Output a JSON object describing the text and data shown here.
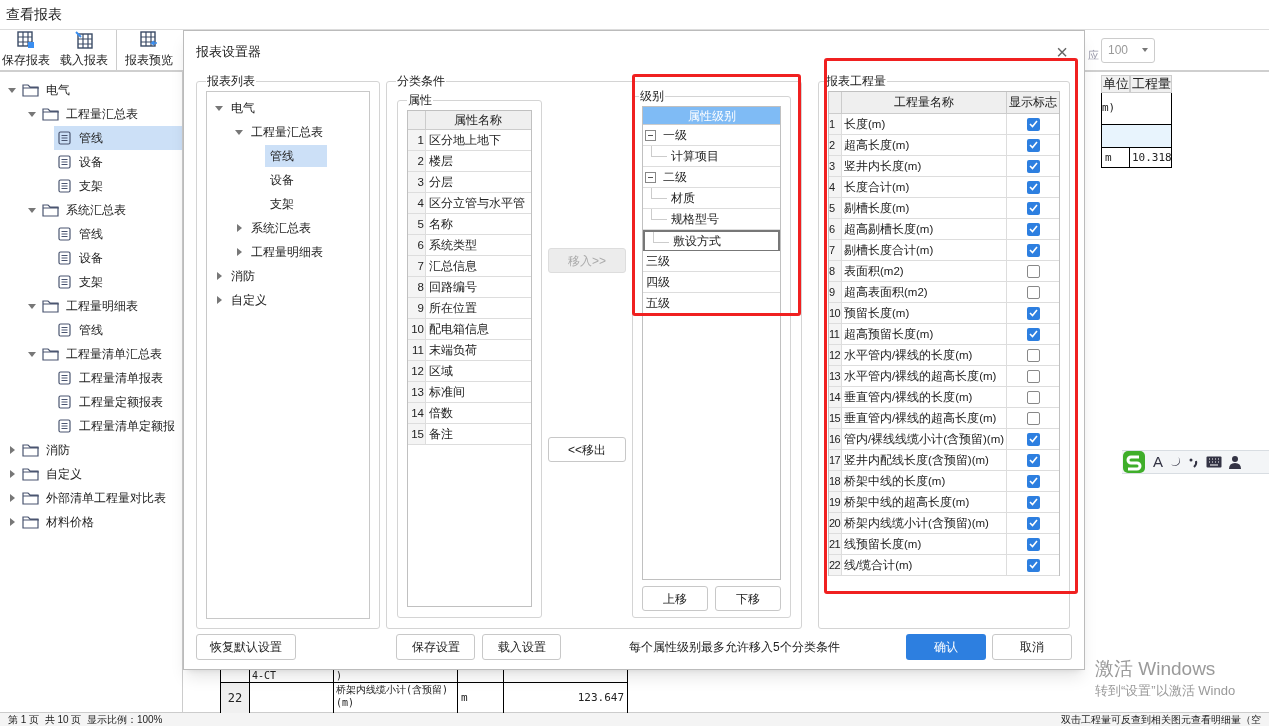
{
  "window": {
    "title": "查看报表"
  },
  "toolbar": [
    {
      "label": "保存报表"
    },
    {
      "label": "载入报表"
    },
    {
      "label": "报表预览"
    }
  ],
  "sidebar": {
    "tree": [
      {
        "kind": "folder",
        "label": "电气",
        "expanded": true,
        "selected": false,
        "children": [
          {
            "kind": "folder",
            "label": "工程量汇总表",
            "expanded": true,
            "selected": false,
            "children": [
              {
                "kind": "report",
                "label": "管线",
                "selected": true
              },
              {
                "kind": "report",
                "label": "设备",
                "selected": false
              },
              {
                "kind": "report",
                "label": "支架",
                "selected": false
              }
            ]
          },
          {
            "kind": "folder",
            "label": "系统汇总表",
            "expanded": true,
            "selected": false,
            "children": [
              {
                "kind": "report",
                "label": "管线",
                "selected": false
              },
              {
                "kind": "report",
                "label": "设备",
                "selected": false
              },
              {
                "kind": "report",
                "label": "支架",
                "selected": false
              }
            ]
          },
          {
            "kind": "folder",
            "label": "工程量明细表",
            "expanded": true,
            "selected": false,
            "children": [
              {
                "kind": "report",
                "label": "管线",
                "selected": false
              }
            ]
          },
          {
            "kind": "folder",
            "label": "工程量清单汇总表",
            "expanded": true,
            "selected": false,
            "children": [
              {
                "kind": "report",
                "label": "工程量清单报表",
                "selected": false
              },
              {
                "kind": "report",
                "label": "工程量定额报表",
                "selected": false
              },
              {
                "kind": "report",
                "label": "工程量清单定额报",
                "selected": false
              }
            ]
          }
        ]
      },
      {
        "kind": "folder",
        "label": "消防",
        "expanded": false,
        "selected": false
      },
      {
        "kind": "folder",
        "label": "自定义",
        "expanded": false,
        "selected": false
      },
      {
        "kind": "folder",
        "label": "外部清单工程量对比表",
        "expanded": false,
        "selected": false
      },
      {
        "kind": "folder",
        "label": "材料价格",
        "expanded": false,
        "selected": false
      }
    ]
  },
  "preview": {
    "partial_label": "应",
    "zoom": "100",
    "columns": [
      "单位",
      "工程量"
    ],
    "top_rows": [
      {
        "text": "m)"
      },
      {
        "unit": "m",
        "amount": "10.318"
      }
    ],
    "bottom_rows": [
      {
        "code": "4-CT",
        "name": ")"
      },
      {
        "number": "22",
        "name": "桥架内线缆小计(含预留)(m)",
        "unit": "m",
        "amount": "123.647"
      }
    ]
  },
  "dialog": {
    "title": "报表设置器",
    "close": "×",
    "report_list": {
      "title": "报表列表",
      "tree": [
        {
          "kind": "folder",
          "label": "电气",
          "expanded": true,
          "selected": false,
          "children": [
            {
              "kind": "folder",
              "label": "工程量汇总表",
              "expanded": true,
              "selected": false,
              "children": [
                {
                  "kind": "report",
                  "label": "管线",
                  "selected": true
                },
                {
                  "kind": "report",
                  "label": "设备",
                  "selected": false
                },
                {
                  "kind": "report",
                  "label": "支架",
                  "selected": false
                }
              ]
            },
            {
              "kind": "folder",
              "label": "系统汇总表",
              "expanded": false,
              "selected": false
            },
            {
              "kind": "folder",
              "label": "工程量明细表",
              "expanded": false,
              "selected": false
            }
          ]
        },
        {
          "kind": "folder",
          "label": "消防",
          "expanded": false,
          "selected": false
        },
        {
          "kind": "folder",
          "label": "自定义",
          "expanded": false,
          "selected": false
        }
      ]
    },
    "conditions": {
      "title": "分类条件",
      "attributes": {
        "title": "属性",
        "column": "属性名称",
        "rows": [
          {
            "no": "1",
            "name": "区分地上地下"
          },
          {
            "no": "2",
            "name": "楼层"
          },
          {
            "no": "3",
            "name": "分层"
          },
          {
            "no": "4",
            "name": "区分立管与水平管"
          },
          {
            "no": "5",
            "name": "名称"
          },
          {
            "no": "6",
            "name": "系统类型"
          },
          {
            "no": "7",
            "name": "汇总信息"
          },
          {
            "no": "8",
            "name": "回路编号"
          },
          {
            "no": "9",
            "name": "所在位置"
          },
          {
            "no": "10",
            "name": "配电箱信息"
          },
          {
            "no": "11",
            "name": "末端负荷"
          },
          {
            "no": "12",
            "name": "区域"
          },
          {
            "no": "13",
            "name": "标准间"
          },
          {
            "no": "14",
            "name": "倍数"
          },
          {
            "no": "15",
            "name": "备注"
          }
        ]
      },
      "move_in": {
        "label": "移入>>",
        "disabled": true
      },
      "move_out": {
        "label": "<<移出",
        "disabled": false
      },
      "levels": {
        "title": "级别",
        "column": "属性级别",
        "items": [
          {
            "kind": "group",
            "label": "一级",
            "expanded": true,
            "selected": false,
            "children": [
              {
                "label": "计算项目",
                "selected": false
              }
            ]
          },
          {
            "kind": "group",
            "label": "二级",
            "expanded": true,
            "selected": false,
            "children": [
              {
                "label": "材质",
                "selected": false
              },
              {
                "label": "规格型号",
                "selected": false
              },
              {
                "label": "敷设方式",
                "selected": true
              }
            ]
          },
          {
            "kind": "plain",
            "label": "三级",
            "selected": false
          },
          {
            "kind": "plain",
            "label": "四级",
            "selected": false
          },
          {
            "kind": "plain",
            "label": "五级",
            "selected": false
          }
        ],
        "buttons": [
          "上移",
          "下移"
        ]
      }
    },
    "quantities": {
      "title": "报表工程量",
      "columns": [
        "工程量名称",
        "显示标志"
      ],
      "rows": [
        {
          "no": "1",
          "name": "长度(m)",
          "checked": true
        },
        {
          "no": "2",
          "name": "超高长度(m)",
          "checked": true
        },
        {
          "no": "3",
          "name": "竖井内长度(m)",
          "checked": true
        },
        {
          "no": "4",
          "name": "长度合计(m)",
          "checked": true
        },
        {
          "no": "5",
          "name": "剔槽长度(m)",
          "checked": true
        },
        {
          "no": "6",
          "name": "超高剔槽长度(m)",
          "checked": true
        },
        {
          "no": "7",
          "name": "剔槽长度合计(m)",
          "checked": true
        },
        {
          "no": "8",
          "name": "表面积(m2)",
          "checked": false
        },
        {
          "no": "9",
          "name": "超高表面积(m2)",
          "checked": false
        },
        {
          "no": "10",
          "name": "预留长度(m)",
          "checked": true
        },
        {
          "no": "11",
          "name": "超高预留长度(m)",
          "checked": true
        },
        {
          "no": "12",
          "name": "水平管内/裸线的长度(m)",
          "checked": false
        },
        {
          "no": "13",
          "name": "水平管内/裸线的超高长度(m)",
          "checked": false
        },
        {
          "no": "14",
          "name": "垂直管内/裸线的长度(m)",
          "checked": false
        },
        {
          "no": "15",
          "name": "垂直管内/裸线的超高长度(m)",
          "checked": false
        },
        {
          "no": "16",
          "name": "管内/裸线线缆小计(含预留)(m)",
          "checked": true
        },
        {
          "no": "17",
          "name": "竖井内配线长度(含预留)(m)",
          "checked": true
        },
        {
          "no": "18",
          "name": "桥架中线的长度(m)",
          "checked": true
        },
        {
          "no": "19",
          "name": "桥架中线的超高长度(m)",
          "checked": true
        },
        {
          "no": "20",
          "name": "桥架内线缆小计(含预留)(m)",
          "checked": true
        },
        {
          "no": "21",
          "name": "线预留长度(m)",
          "checked": true
        },
        {
          "no": "22",
          "name": "线/缆合计(m)",
          "checked": true
        }
      ]
    },
    "footer": {
      "reset": "恢复默认设置",
      "save": "保存设置",
      "load": "载入设置",
      "note": "每个属性级别最多允许移入5个分类条件",
      "ok": "确认",
      "cancel": "取消"
    }
  },
  "status_bar": {
    "page": "第 1 页  共 10 页  显示比例：100%",
    "hint": "双击工程量可反查到相关图元查看明细量（空"
  },
  "ime_bar": {
    "mode": "A"
  },
  "activation_notice": {
    "title": "激活 Windows",
    "text": "转到“设置”以激活 Windo"
  }
}
